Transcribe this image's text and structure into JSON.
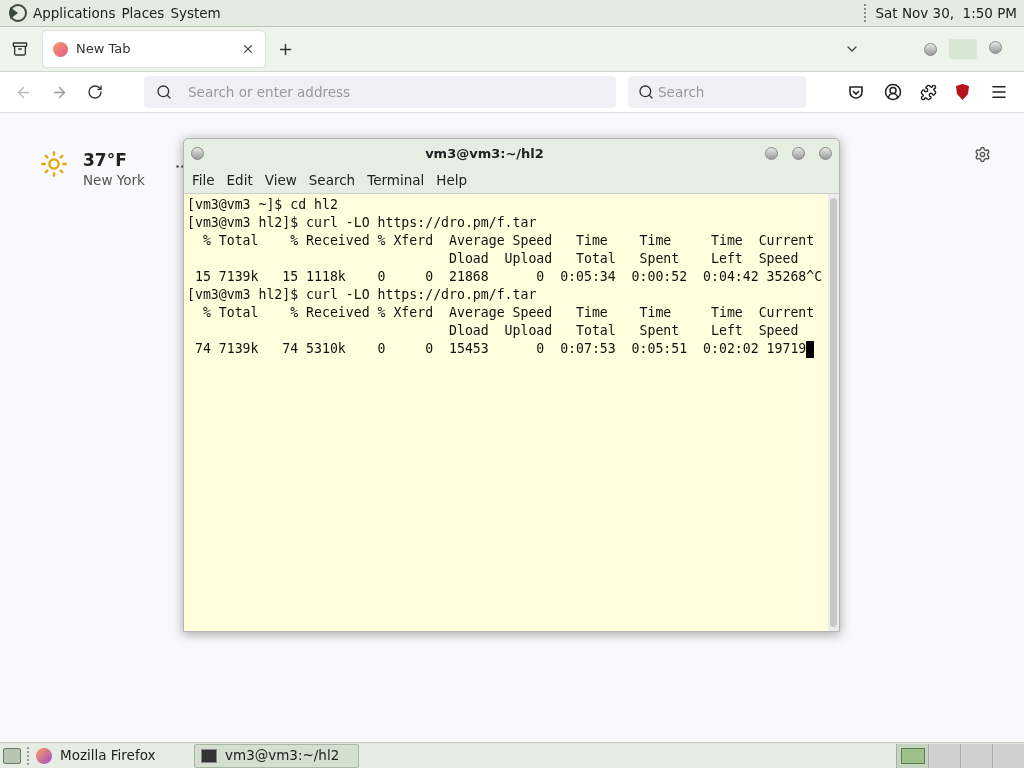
{
  "top_panel": {
    "menus": [
      "Applications",
      "Places",
      "System"
    ],
    "clock": "Sat Nov 30,  1:50 PM"
  },
  "browser": {
    "tabs": [
      {
        "label": "New Tab",
        "selected": true
      }
    ],
    "address": {
      "placeholder": "Search or enter address"
    },
    "search": {
      "placeholder": "Search"
    },
    "weather": {
      "temperature": "37°F",
      "city": "New York"
    }
  },
  "terminal": {
    "title": "vm3@vm3:~/hl2",
    "menus": [
      "File",
      "Edit",
      "View",
      "Search",
      "Terminal",
      "Help"
    ],
    "lines": [
      "[vm3@vm3 ~]$ cd hl2",
      "[vm3@vm3 hl2]$ curl -LO https://dro.pm/f.tar",
      "  % Total    % Received % Xferd  Average Speed   Time    Time     Time  Current",
      "                                 Dload  Upload   Total   Spent    Left  Speed",
      " 15 7139k   15 1118k    0     0  21868      0  0:05:34  0:00:52  0:04:42 35268^C",
      "[vm3@vm3 hl2]$ curl -LO https://dro.pm/f.tar",
      "  % Total    % Received % Xferd  Average Speed   Time    Time     Time  Current",
      "                                 Dload  Upload   Total   Spent    Left  Speed",
      " 74 7139k   74 5310k    0     0  15453      0  0:07:53  0:05:51  0:02:02 19719"
    ]
  },
  "taskbar": {
    "tasks": [
      {
        "label": "Mozilla Firefox",
        "kind": "firefox",
        "selected": false
      },
      {
        "label": "vm3@vm3:~/hl2",
        "kind": "terminal",
        "selected": true
      }
    ],
    "workspaces": [
      {
        "selected": true
      },
      {
        "selected": false
      },
      {
        "selected": false
      },
      {
        "selected": false
      }
    ]
  }
}
